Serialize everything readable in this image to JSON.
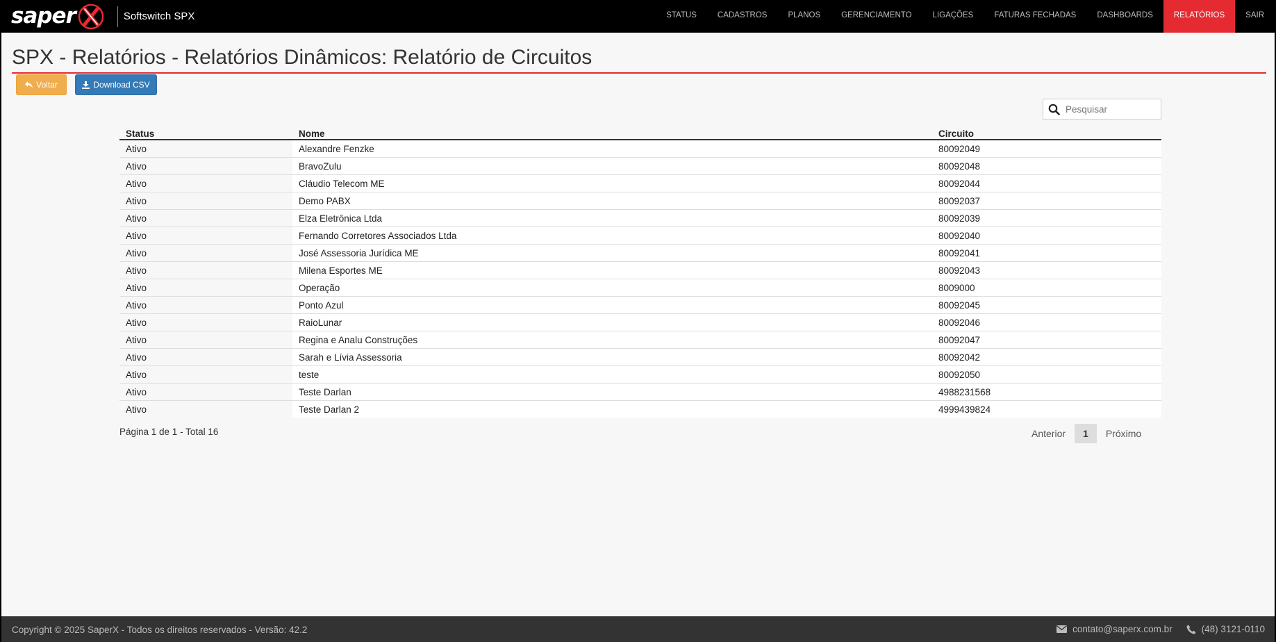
{
  "brand": {
    "logo_text": "saper",
    "product": "Softswitch SPX"
  },
  "nav": [
    "STATUS",
    "CADASTROS",
    "PLANOS",
    "GERENCIAMENTO",
    "LIGAÇÕES",
    "FATURAS FECHADAS",
    "DASHBOARDS",
    "RELATÓRIOS",
    "SAIR"
  ],
  "nav_active": 7,
  "page": {
    "title": "SPX - Relatórios - Relatórios Dinâmicos: Relatório de Circuitos"
  },
  "buttons": {
    "back": "Voltar",
    "csv": "Download CSV"
  },
  "search": {
    "placeholder": "Pesquisar"
  },
  "table": {
    "headers": [
      "Status",
      "Nome",
      "Circuito"
    ],
    "rows": [
      [
        "Ativo",
        "Alexandre Fenzke",
        "80092049"
      ],
      [
        "Ativo",
        "BravoZulu",
        "80092048"
      ],
      [
        "Ativo",
        "Cláudio Telecom ME",
        "80092044"
      ],
      [
        "Ativo",
        "Demo PABX",
        "80092037"
      ],
      [
        "Ativo",
        "Elza Eletrônica Ltda",
        "80092039"
      ],
      [
        "Ativo",
        "Fernando Corretores Associados Ltda",
        "80092040"
      ],
      [
        "Ativo",
        "José Assessoria Jurídica ME",
        "80092041"
      ],
      [
        "Ativo",
        "Milena Esportes ME",
        "80092043"
      ],
      [
        "Ativo",
        "Operação",
        "8009000"
      ],
      [
        "Ativo",
        "Ponto Azul",
        "80092045"
      ],
      [
        "Ativo",
        "RaioLunar",
        "80092046"
      ],
      [
        "Ativo",
        "Regina e Analu Construções",
        "80092047"
      ],
      [
        "Ativo",
        "Sarah e Lívia Assessoria",
        "80092042"
      ],
      [
        "Ativo",
        "teste",
        "80092050"
      ],
      [
        "Ativo",
        "Teste Darlan",
        "4988231568"
      ],
      [
        "Ativo",
        "Teste Darlan 2",
        "4999439824"
      ]
    ]
  },
  "pagination": {
    "info": "Página 1 de 1 - Total 16",
    "prev": "Anterior",
    "current": "1",
    "next": "Próximo"
  },
  "footer": {
    "copyright": "Copyright © 2025 SaperX - Todos os direitos reservados - Versão: 42.2",
    "email": "contato@saperx.com.br",
    "phone": "(48) 3121-0110"
  },
  "colors": {
    "accent": "#e62a31",
    "warning": "#f0ad4e",
    "primary": "#337ab7"
  }
}
